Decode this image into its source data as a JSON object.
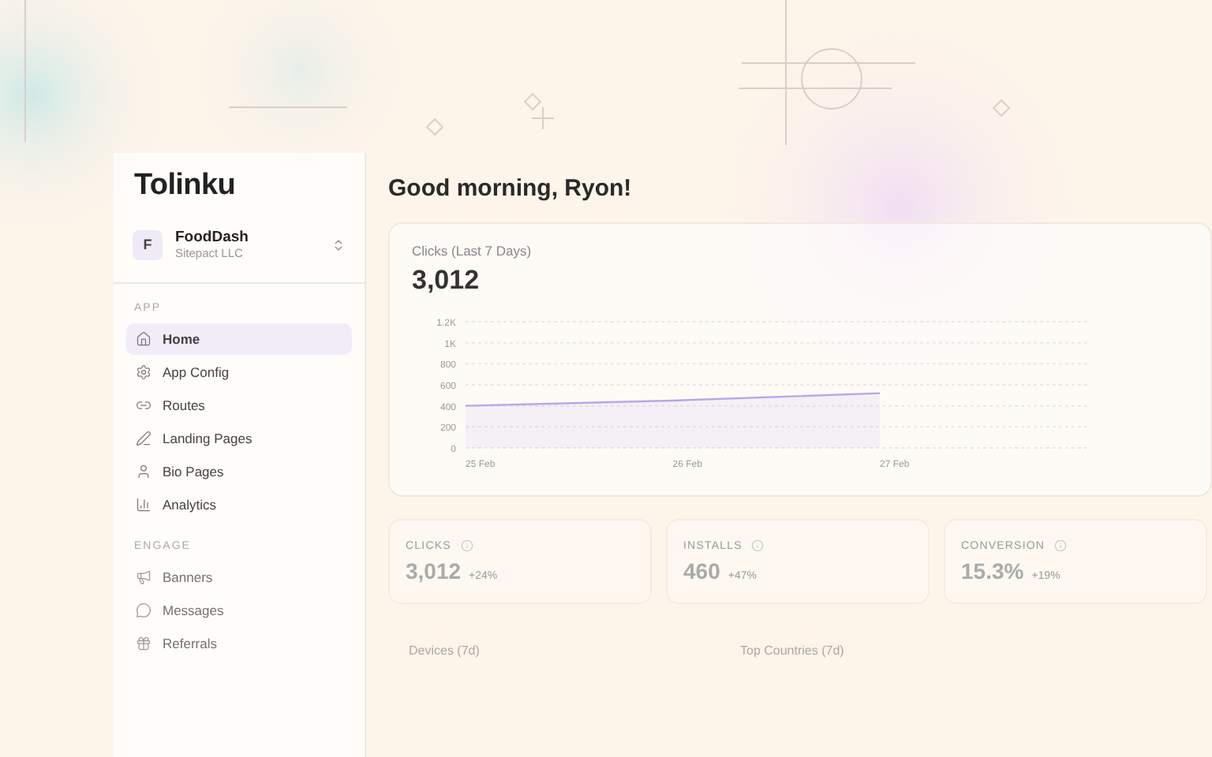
{
  "logo": "Tolinku",
  "workspace": {
    "initial": "F",
    "name": "FoodDash",
    "org": "Sitepact LLC"
  },
  "sidebar": {
    "sections": [
      {
        "title": "APP",
        "items": [
          {
            "label": "Home",
            "selected": true
          },
          {
            "label": "App Config",
            "selected": false
          },
          {
            "label": "Routes",
            "selected": false
          },
          {
            "label": "Landing Pages",
            "selected": false
          },
          {
            "label": "Bio Pages",
            "selected": false
          },
          {
            "label": "Analytics",
            "selected": false
          }
        ]
      },
      {
        "title": "ENGAGE",
        "items": [
          {
            "label": "Banners",
            "selected": false
          },
          {
            "label": "Messages",
            "selected": false
          },
          {
            "label": "Referrals",
            "selected": false
          }
        ]
      }
    ]
  },
  "greeting": "Good morning, Ryon!",
  "clicks_card": {
    "title": "Clicks (Last 7 Days)",
    "total": "3,012",
    "chart_data": {
      "type": "area",
      "grid": true,
      "categories": [
        "25 Feb",
        "26 Feb",
        "27 Feb"
      ],
      "series": [
        {
          "color": "#b9a5ec",
          "values": [
            400,
            450,
            520
          ]
        }
      ],
      "ylim": [
        0,
        1200
      ],
      "yticks": [
        0,
        200,
        400,
        600,
        800,
        {
          "value": 1000,
          "label": "1K"
        },
        {
          "value": 1200,
          "label": "1.2K"
        }
      ]
    }
  },
  "stats": [
    {
      "label": "CLICKS",
      "value": "3,012",
      "change": "+24%"
    },
    {
      "label": "INSTALLS",
      "value": "460",
      "change": "+47%"
    },
    {
      "label": "CONVERSION",
      "value": "15.3%",
      "change": "+19%"
    }
  ],
  "sections": [
    "Devices (7d)",
    "Top Countries (7d)"
  ]
}
